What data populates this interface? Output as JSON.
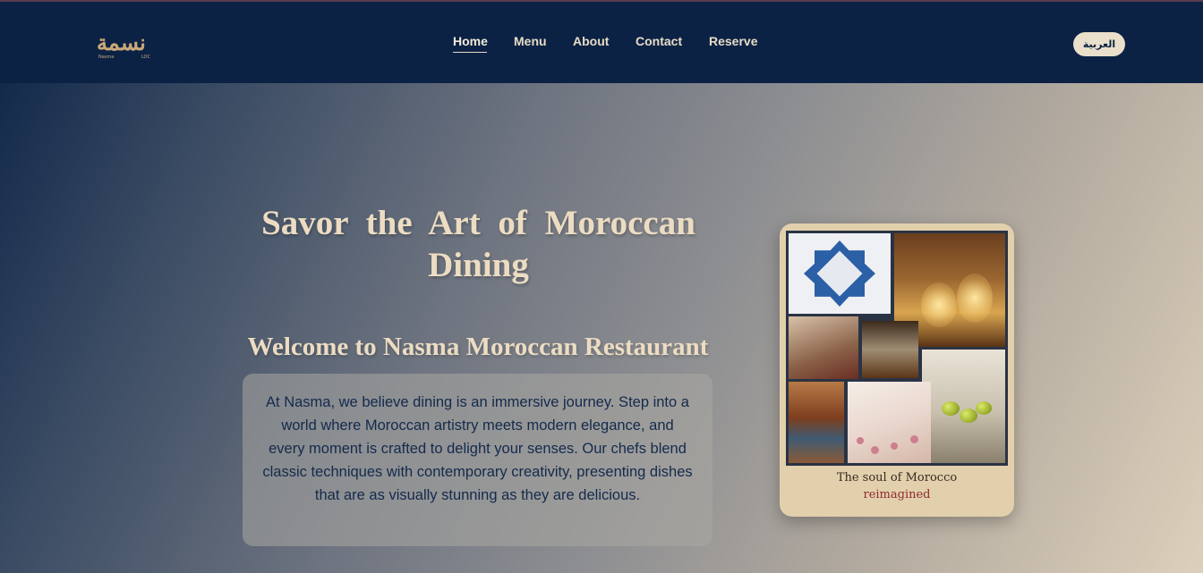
{
  "brand": {
    "logo_text": "نسمة",
    "logo_sub_left": "Nasma",
    "logo_sub_right": "LOC"
  },
  "nav": {
    "items": [
      {
        "label": "Home",
        "active": true
      },
      {
        "label": "Menu",
        "active": false
      },
      {
        "label": "About",
        "active": false
      },
      {
        "label": "Contact",
        "active": false
      },
      {
        "label": "Reserve",
        "active": false
      }
    ],
    "language_button": "العربية"
  },
  "hero": {
    "title": "Savor the Art of Moroccan Dining",
    "welcome": "Welcome to Nasma Moroccan Restaurant",
    "intro": "At Nasma, we believe dining is an immersive journey. Step into a world where Moroccan artistry meets modern elegance, and every moment is crafted to delight your senses. Our chefs blend classic techniques with contemporary creativity, presenting dishes that are as visually stunning as they are delicious."
  },
  "card": {
    "caption_line1": "The soul of Morocco",
    "caption_line2": "reimagined"
  },
  "colors": {
    "navbar": "#0b2245",
    "accent_text": "#ecdcc2",
    "body_text": "#142a4c",
    "caption_accent": "#8f2b2f"
  }
}
